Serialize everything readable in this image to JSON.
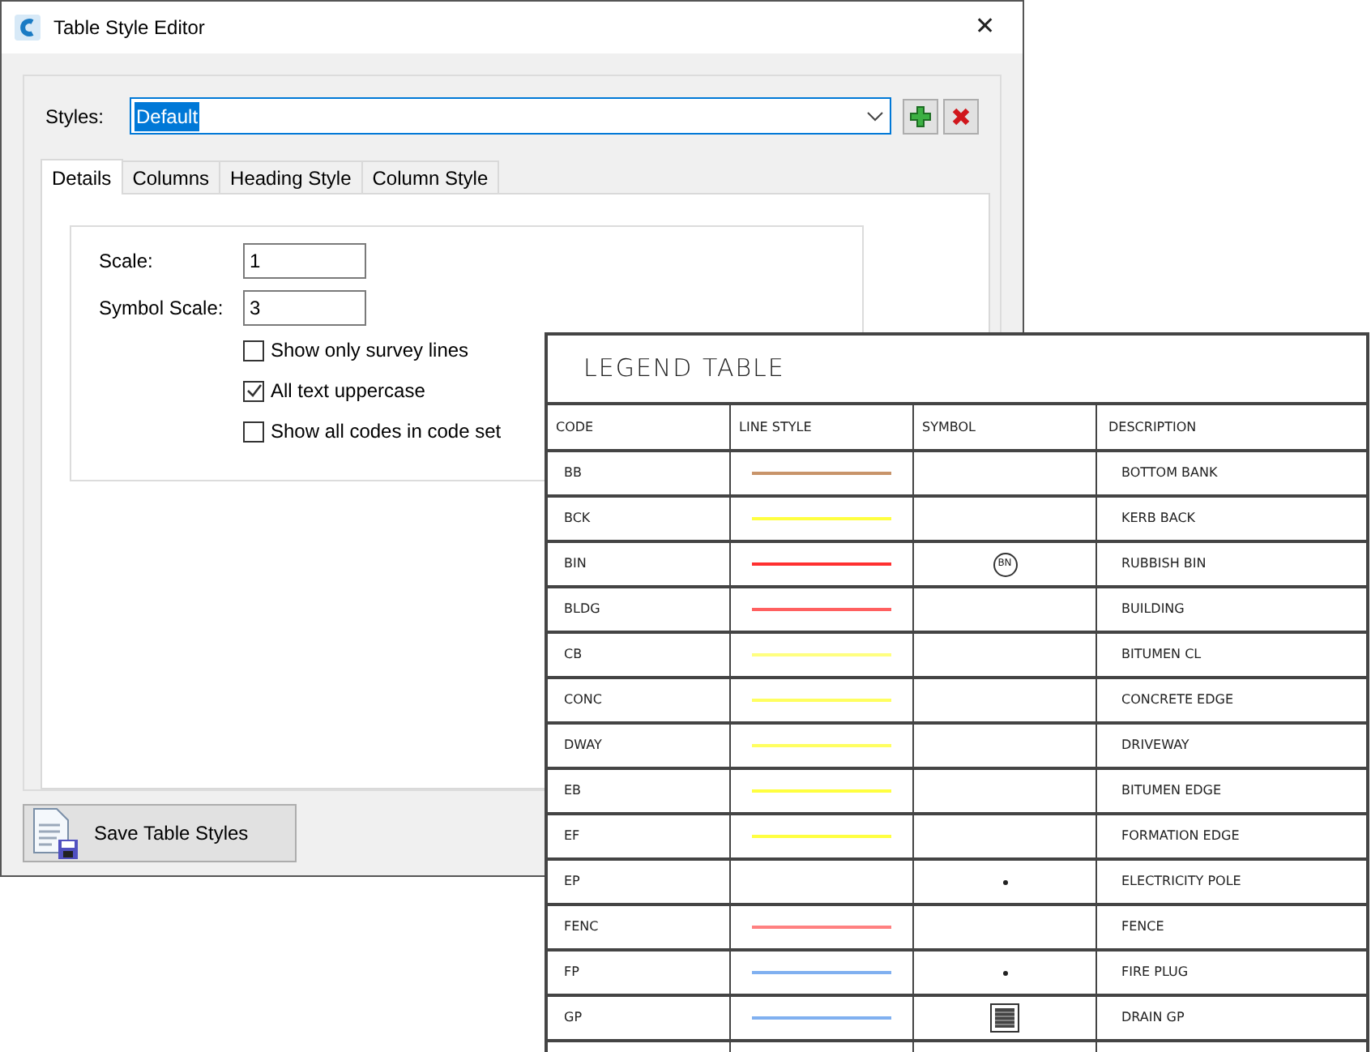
{
  "window": {
    "title": "Table Style Editor",
    "close": "✕"
  },
  "styles": {
    "label": "Styles:",
    "value": "Default"
  },
  "tabs": [
    {
      "label": "Details",
      "selected": true
    },
    {
      "label": "Columns",
      "selected": false
    },
    {
      "label": "Heading Style",
      "selected": false
    },
    {
      "label": "Column Style",
      "selected": false
    }
  ],
  "fields": [
    {
      "label": "Scale:",
      "value": "1"
    },
    {
      "label": "Symbol Scale:",
      "value": "3"
    }
  ],
  "checkboxes": [
    {
      "label": "Show only survey lines",
      "checked": false
    },
    {
      "label": "All text uppercase",
      "checked": true
    },
    {
      "label": "Show all codes in code set",
      "checked": false
    }
  ],
  "save_button": "Save Table Styles",
  "legend": {
    "title": "LEGEND TABLE",
    "columns": [
      "CODE",
      "LINE STYLE",
      "SYMBOL",
      "DESCRIPTION"
    ],
    "rows": [
      {
        "code": "BB",
        "color": "#c8946a",
        "symbol": {
          "kind": "none"
        },
        "description": "BOTTOM BANK"
      },
      {
        "code": "BCK",
        "color": "#ffff40",
        "symbol": {
          "kind": "none"
        },
        "description": "KERB BACK"
      },
      {
        "code": "BIN",
        "color": "#ff3030",
        "symbol": {
          "kind": "circle",
          "text": "BN"
        },
        "description": "RUBBISH BIN"
      },
      {
        "code": "BLDG",
        "color": "#ff6060",
        "symbol": {
          "kind": "none"
        },
        "description": "BUILDING"
      },
      {
        "code": "CB",
        "color": "#ffff80",
        "symbol": {
          "kind": "none"
        },
        "description": "BITUMEN CL"
      },
      {
        "code": "CONC",
        "color": "#ffff60",
        "symbol": {
          "kind": "none"
        },
        "description": "CONCRETE EDGE"
      },
      {
        "code": "DWAY",
        "color": "#ffff60",
        "symbol": {
          "kind": "none"
        },
        "description": "DRIVEWAY"
      },
      {
        "code": "EB",
        "color": "#ffff40",
        "symbol": {
          "kind": "none"
        },
        "description": "BITUMEN EDGE"
      },
      {
        "code": "EF",
        "color": "#ffff40",
        "symbol": {
          "kind": "none"
        },
        "description": "FORMATION EDGE"
      },
      {
        "code": "EP",
        "symbol": {
          "kind": "dot"
        },
        "description": "ELECTRICITY POLE"
      },
      {
        "code": "FENC",
        "color": "#ff8080",
        "symbol": {
          "kind": "none"
        },
        "description": "FENCE"
      },
      {
        "code": "FP",
        "color": "#80b0f0",
        "symbol": {
          "kind": "dot"
        },
        "description": "FIRE PLUG"
      },
      {
        "code": "GP",
        "color": "#80b0f0",
        "symbol": {
          "kind": "grate"
        },
        "description": "DRAIN GP"
      }
    ]
  }
}
